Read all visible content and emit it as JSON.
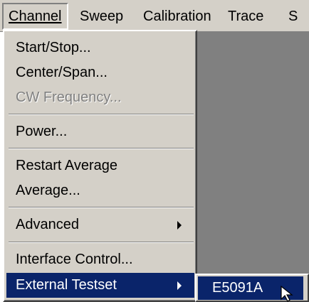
{
  "menubar": {
    "items": [
      {
        "label": "Channel",
        "open": true
      },
      {
        "label": "Sweep"
      },
      {
        "label": "Calibration"
      },
      {
        "label": "Trace"
      },
      {
        "label": "S"
      }
    ]
  },
  "channel_menu": {
    "items": [
      {
        "label": "Start/Stop..."
      },
      {
        "label": "Center/Span..."
      },
      {
        "label": "CW Frequency...",
        "disabled": true
      },
      {
        "label": "Power..."
      },
      {
        "label": "Restart Average"
      },
      {
        "label": "Average..."
      },
      {
        "label": "Advanced",
        "has_submenu": true
      },
      {
        "label": "Interface Control..."
      },
      {
        "label": "External Testset",
        "has_submenu": true,
        "selected": true
      }
    ]
  },
  "submenu": {
    "items": [
      {
        "label": "E5091A",
        "selected": true
      }
    ]
  },
  "colors": {
    "menu_face": "#d4d0c8",
    "selection": "#0a246a",
    "workspace": "#808080"
  },
  "icons": {
    "submenu_arrow": "chevron-right-icon",
    "cursor": "mouse-pointer-icon"
  }
}
